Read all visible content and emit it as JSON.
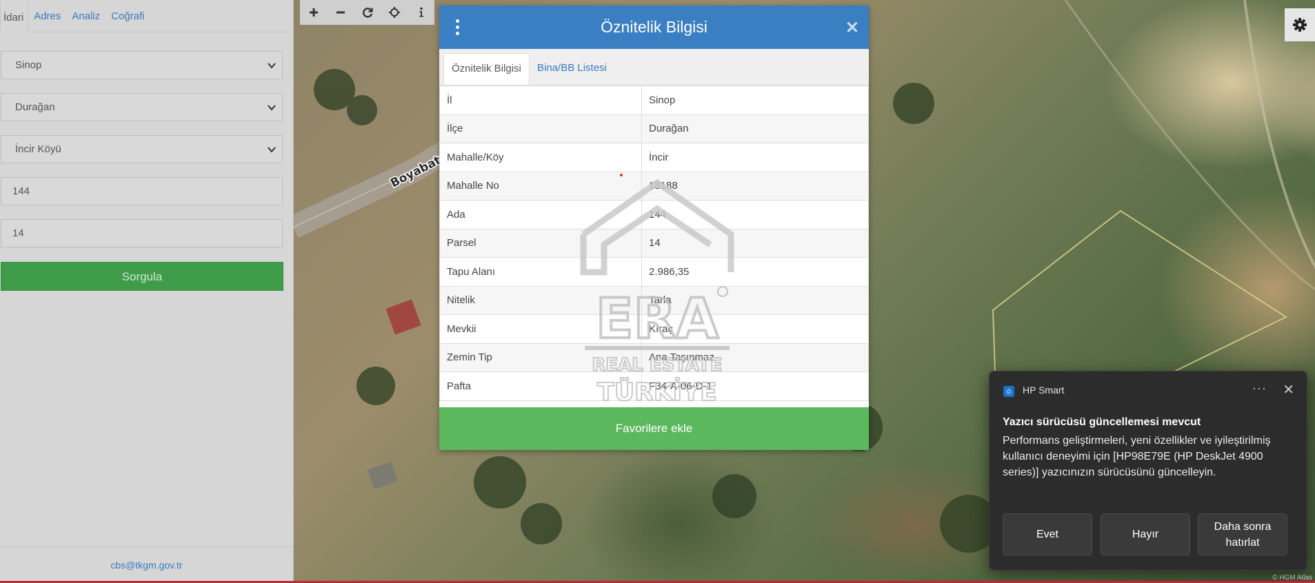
{
  "left_panel": {
    "tabs": [
      "İdari",
      "Adres",
      "Analiz",
      "Coğrafi"
    ],
    "selects": {
      "il": "Sinop",
      "ilce": "Durağan",
      "mahalle": "İncir Köyü"
    },
    "inputs": {
      "ada": "144",
      "parsel": "14"
    },
    "query_button": "Sorgula",
    "footer_email": "cbs@tkgm.gov.tr"
  },
  "map": {
    "road_label": "Boyabat",
    "attribution": "© HGM Atlas"
  },
  "modal": {
    "title": "Öznitelik Bilgisi",
    "tabs": [
      "Öznitelik Bilgisi",
      "Bina/BB Listesi"
    ],
    "rows": [
      {
        "key": "İl",
        "value": "Sinop"
      },
      {
        "key": "İlçe",
        "value": "Durağan"
      },
      {
        "key": "Mahalle/Köy",
        "value": "İncir"
      },
      {
        "key": "Mahalle No",
        "value": "18188"
      },
      {
        "key": "Ada",
        "value": "144"
      },
      {
        "key": "Parsel",
        "value": "14"
      },
      {
        "key": "Tapu Alanı",
        "value": "2.986,35"
      },
      {
        "key": "Nitelik",
        "value": "Tarla"
      },
      {
        "key": "Mevkii",
        "value": "Kıraç"
      },
      {
        "key": "Zemin Tip",
        "value": "Ana Taşınmaz"
      },
      {
        "key": "Pafta",
        "value": "F34-A-06-D-1"
      }
    ],
    "favorite_button": "Favorilere ekle"
  },
  "watermark": {
    "brand": "ERA",
    "line1": "REAL ESTATE",
    "line2": "TÜRKİYE"
  },
  "toast": {
    "app": "HP Smart",
    "heading": "Yazıcı sürücüsü güncellemesi mevcut",
    "body": "Performans geliştirmeleri, yeni özellikler ve iyileştirilmiş kullanıcı deneyimi için [HP98E79E (HP DeskJet 4900 series)] yazıcınızın sürücüsünü güncelleyin.",
    "buttons": [
      "Evet",
      "Hayır",
      "Daha sonra hatırlat"
    ]
  },
  "colors": {
    "modal_header": "#3a7fc1",
    "favorite_green": "#5cb85c",
    "query_green": "#3f9d49",
    "link_blue": "#3a7bbd",
    "toast_bg": "#2c2c2c"
  }
}
